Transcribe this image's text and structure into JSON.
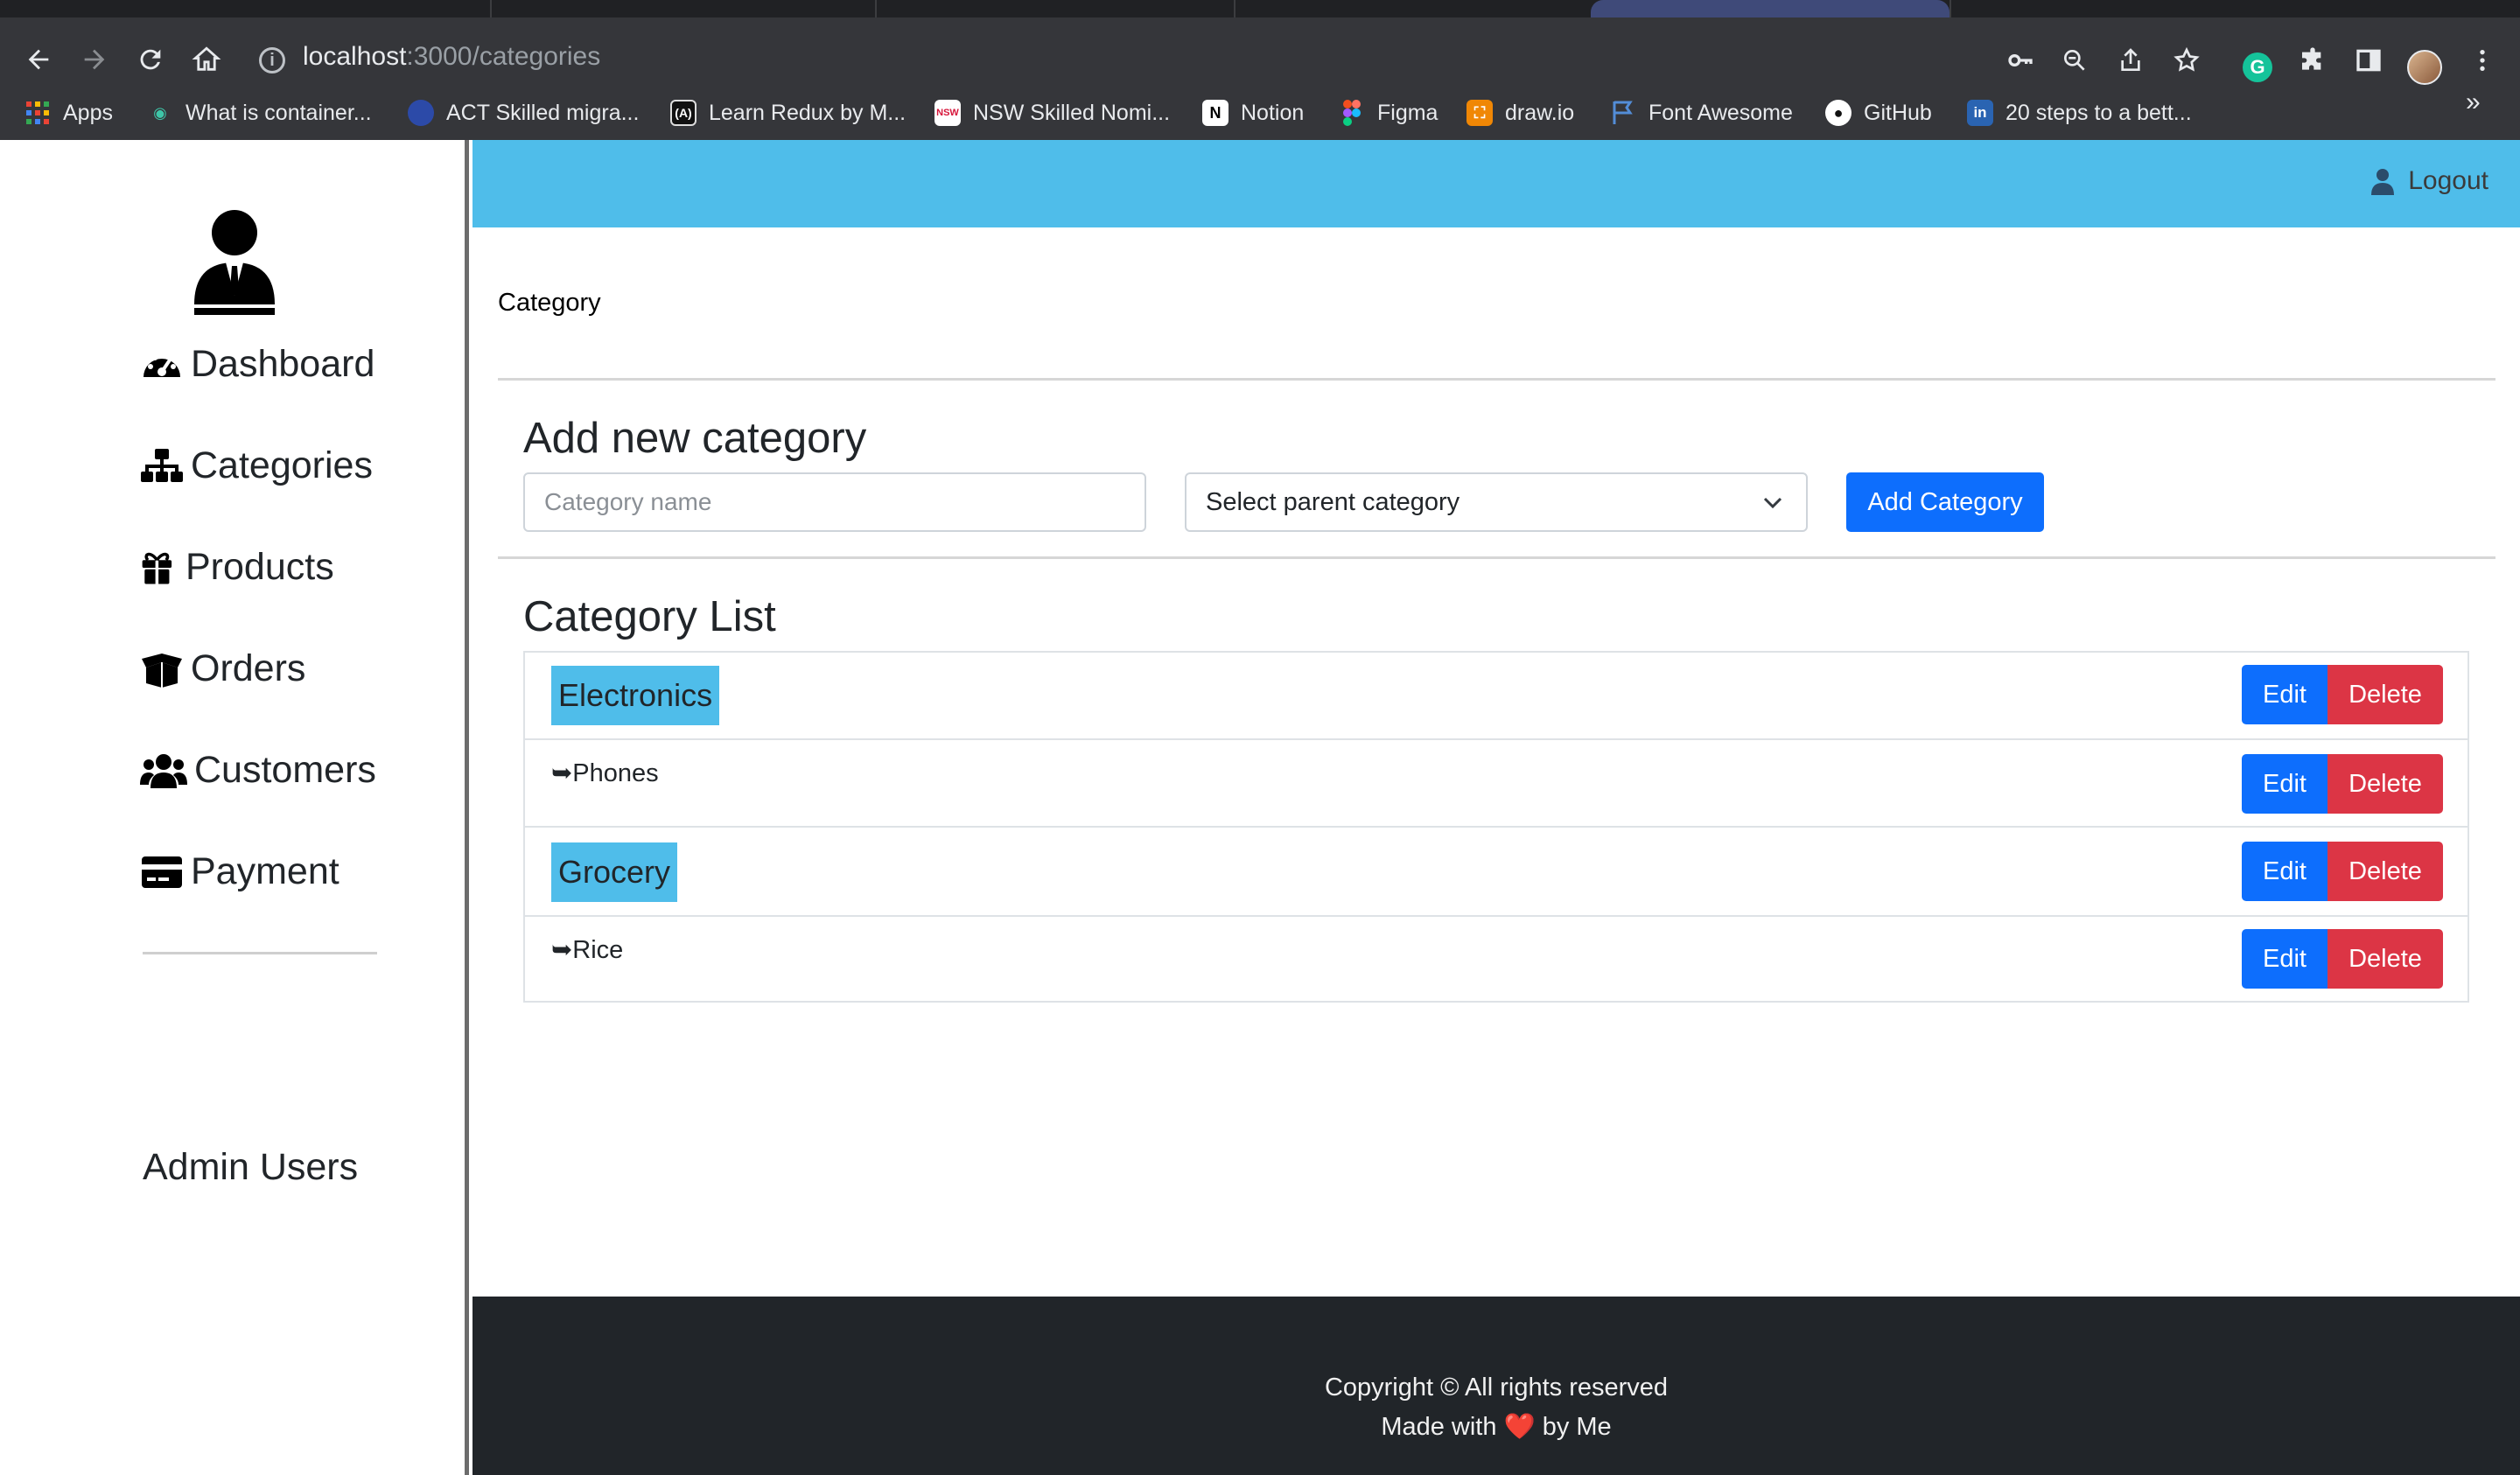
{
  "browser": {
    "url_host": "localhost",
    "url_path": ":3000/categories",
    "bookmarks": [
      {
        "label": "Apps",
        "icon": "apps-grid-icon"
      },
      {
        "label": "What is container...",
        "icon": "eye-icon"
      },
      {
        "label": "ACT Skilled migra...",
        "icon": "act-icon"
      },
      {
        "label": "Learn Redux by M...",
        "icon": "react-icon"
      },
      {
        "label": "NSW Skilled Nomi...",
        "icon": "nsw-icon"
      },
      {
        "label": "Notion",
        "icon": "notion-icon"
      },
      {
        "label": "Figma",
        "icon": "figma-icon"
      },
      {
        "label": "draw.io",
        "icon": "drawio-icon"
      },
      {
        "label": "Font Awesome",
        "icon": "flag-icon"
      },
      {
        "label": "GitHub",
        "icon": "github-icon"
      },
      {
        "label": "20 steps to a bett...",
        "icon": "linkedin-icon"
      }
    ],
    "more": "»"
  },
  "sidebar": {
    "items": [
      {
        "label": "Dashboard",
        "icon": "gauge-icon"
      },
      {
        "label": "Categories",
        "icon": "sitemap-icon"
      },
      {
        "label": "Products",
        "icon": "gift-icon"
      },
      {
        "label": "Orders",
        "icon": "box-open-icon"
      },
      {
        "label": "Customers",
        "icon": "users-icon"
      },
      {
        "label": "Payment",
        "icon": "credit-card-icon"
      }
    ],
    "admin_users": "Admin Users"
  },
  "header": {
    "logout": "Logout"
  },
  "main": {
    "page_label": "Category",
    "add_section": {
      "title": "Add new category",
      "name_placeholder": "Category name",
      "parent_select_value": "Select parent category",
      "add_button": "Add Category"
    },
    "list_section": {
      "title": "Category List",
      "edit_label": "Edit",
      "delete_label": "Delete",
      "rows": [
        {
          "name": "Electronics",
          "level": "parent"
        },
        {
          "name": "➥Phones",
          "level": "child"
        },
        {
          "name": "Grocery",
          "level": "parent"
        },
        {
          "name": "➥Rice",
          "level": "child"
        }
      ]
    }
  },
  "footer": {
    "line1": "Copyright © All rights reserved",
    "line2_prefix": "Made with ",
    "line2_heart": "❤️",
    "line2_suffix": " by Me"
  },
  "colors": {
    "accent": "#4fbdea",
    "primary": "#0d6efd",
    "danger": "#dc3545",
    "footer_bg": "#212529",
    "chrome_bg": "#35363a"
  }
}
